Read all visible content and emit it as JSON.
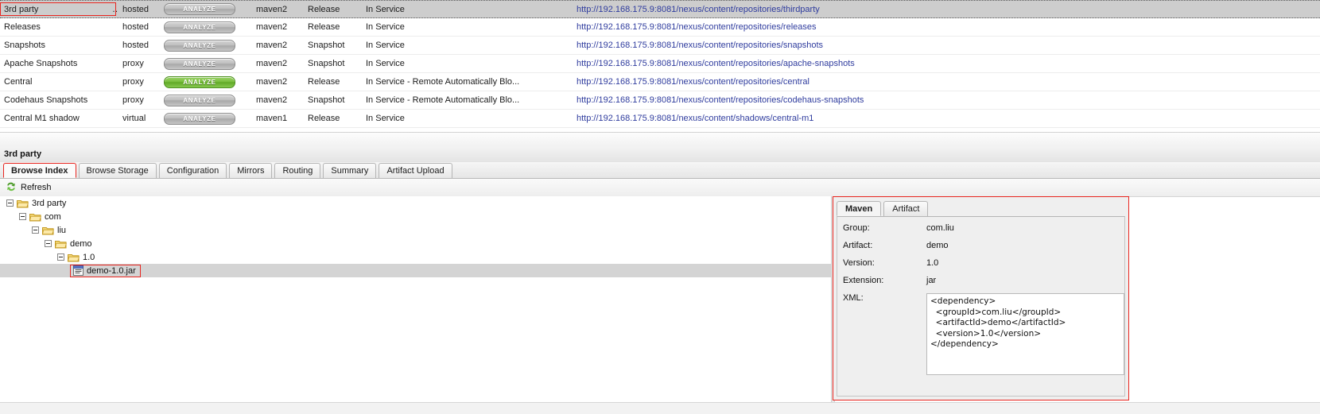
{
  "repo_grid": {
    "rows": [
      {
        "name": "3rd party",
        "type": "hosted",
        "analyze": "ANALYZE",
        "analyze_state": "gray",
        "format": "maven2",
        "policy": "Release",
        "status": "In Service",
        "url": "http://192.168.175.9:8081/nexus/content/repositories/thirdparty",
        "selected": true,
        "outlined": true
      },
      {
        "name": "Releases",
        "type": "hosted",
        "analyze": "ANALYZE",
        "analyze_state": "gray",
        "format": "maven2",
        "policy": "Release",
        "status": "In Service",
        "url": "http://192.168.175.9:8081/nexus/content/repositories/releases",
        "selected": false,
        "outlined": false
      },
      {
        "name": "Snapshots",
        "type": "hosted",
        "analyze": "ANALYZE",
        "analyze_state": "gray",
        "format": "maven2",
        "policy": "Snapshot",
        "status": "In Service",
        "url": "http://192.168.175.9:8081/nexus/content/repositories/snapshots",
        "selected": false,
        "outlined": false
      },
      {
        "name": "Apache Snapshots",
        "type": "proxy",
        "analyze": "ANALYZE",
        "analyze_state": "gray",
        "format": "maven2",
        "policy": "Snapshot",
        "status": "In Service",
        "url": "http://192.168.175.9:8081/nexus/content/repositories/apache-snapshots",
        "selected": false,
        "outlined": false
      },
      {
        "name": "Central",
        "type": "proxy",
        "analyze": "ANALYZE",
        "analyze_state": "green",
        "format": "maven2",
        "policy": "Release",
        "status": "In Service - Remote Automatically Blo...",
        "url": "http://192.168.175.9:8081/nexus/content/repositories/central",
        "selected": false,
        "outlined": false
      },
      {
        "name": "Codehaus Snapshots",
        "type": "proxy",
        "analyze": "ANALYZE",
        "analyze_state": "gray",
        "format": "maven2",
        "policy": "Snapshot",
        "status": "In Service - Remote Automatically Blo...",
        "url": "http://192.168.175.9:8081/nexus/content/repositories/codehaus-snapshots",
        "selected": false,
        "outlined": false
      },
      {
        "name": "Central M1 shadow",
        "type": "virtual",
        "analyze": "ANALYZE",
        "analyze_state": "gray",
        "format": "maven1",
        "policy": "Release",
        "status": "In Service",
        "url": "http://192.168.175.9:8081/nexus/content/shadows/central-m1",
        "selected": false,
        "outlined": false
      }
    ]
  },
  "panel": {
    "title": "3rd party",
    "tabs": [
      {
        "label": "Browse Index",
        "active": true
      },
      {
        "label": "Browse Storage",
        "active": false
      },
      {
        "label": "Configuration",
        "active": false
      },
      {
        "label": "Mirrors",
        "active": false
      },
      {
        "label": "Routing",
        "active": false
      },
      {
        "label": "Summary",
        "active": false
      },
      {
        "label": "Artifact Upload",
        "active": false
      }
    ],
    "refresh_label": "Refresh"
  },
  "tree": {
    "nodes": [
      {
        "label": "3rd party",
        "depth": 0,
        "kind": "folder",
        "selected": false,
        "outlined": false
      },
      {
        "label": "com",
        "depth": 1,
        "kind": "folder",
        "selected": false,
        "outlined": false
      },
      {
        "label": "liu",
        "depth": 2,
        "kind": "folder",
        "selected": false,
        "outlined": false
      },
      {
        "label": "demo",
        "depth": 3,
        "kind": "folder",
        "selected": false,
        "outlined": false
      },
      {
        "label": "1.0",
        "depth": 4,
        "kind": "folder",
        "selected": false,
        "outlined": false
      },
      {
        "label": "demo-1.0.jar",
        "depth": 5,
        "kind": "file",
        "selected": true,
        "outlined": true
      }
    ]
  },
  "detail": {
    "tabs": [
      {
        "label": "Maven",
        "active": true
      },
      {
        "label": "Artifact",
        "active": false
      }
    ],
    "fields": [
      {
        "label": "Group:",
        "value": "com.liu"
      },
      {
        "label": "Artifact:",
        "value": "demo"
      },
      {
        "label": "Version:",
        "value": "1.0"
      },
      {
        "label": "Extension:",
        "value": "jar"
      }
    ],
    "xml_label": "XML:",
    "xml_value": "<dependency>\n  <groupId>com.liu</groupId>\n  <artifactId>demo</artifactId>\n  <version>1.0</version>\n</dependency>"
  },
  "colors": {
    "highlight_outline": "#e8251f",
    "link": "#2f3c9e",
    "analyze_green": "#79bf3e",
    "analyze_gray": "#bfbfbf",
    "selected_row": "#cdcdcd"
  }
}
